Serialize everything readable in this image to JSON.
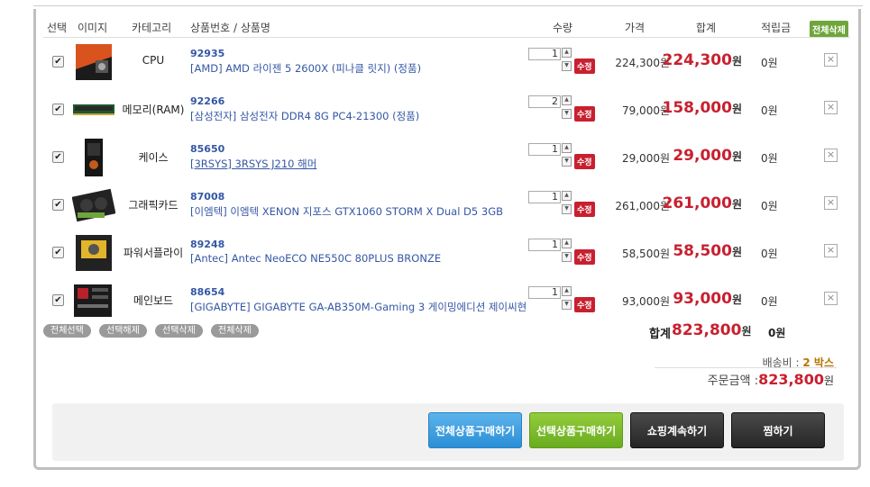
{
  "header": {
    "select": "선택",
    "image": "이미지",
    "category": "카테고리",
    "product": "상품번호 / 상품명",
    "qty": "수량",
    "price": "가격",
    "total": "합계",
    "points": "적립금",
    "delete_all": "전체삭제"
  },
  "items": [
    {
      "category": "CPU",
      "code": "92935",
      "name": "[AMD] AMD 라이젠 5 2600X (피나클 릿지) (정품)",
      "qty": "1",
      "price": "224,300원",
      "total": "224,300",
      "points": "0원",
      "thumb": "cpu-box",
      "link": false
    },
    {
      "category": "메모리(RAM)",
      "code": "92266",
      "name": "[삼성전자] 삼성전자 DDR4 8G PC4-21300 (정품)",
      "qty": "2",
      "price": "79,000원",
      "total": "158,000",
      "points": "0원",
      "thumb": "ram-stick",
      "link": false
    },
    {
      "category": "케이스",
      "code": "85650",
      "name": "[3RSYS] 3RSYS J210 해머",
      "qty": "1",
      "price": "29,000원",
      "total": "29,000",
      "points": "0원",
      "thumb": "pc-case",
      "link": true
    },
    {
      "category": "그래픽카드",
      "code": "87008",
      "name": "[이엠텍] 이엠텍 XENON 지포스 GTX1060 STORM X Dual D5 3GB",
      "qty": "1",
      "price": "261,000원",
      "total": "261,000",
      "points": "0원",
      "thumb": "gpu",
      "link": false
    },
    {
      "category": "파워서플라이",
      "code": "89248",
      "name": "[Antec] Antec NeoECO NE550C 80PLUS BRONZE",
      "qty": "1",
      "price": "58,500원",
      "total": "58,500",
      "points": "0원",
      "thumb": "psu",
      "link": false
    },
    {
      "category": "메인보드",
      "code": "88654",
      "name": "[GIGABYTE] GIGABYTE GA-AB350M-Gaming 3 게이밍에디션 제이씨현",
      "qty": "1",
      "price": "93,000원",
      "total": "93,000",
      "points": "0원",
      "thumb": "mainboard",
      "link": false
    }
  ],
  "row_labels": {
    "won": "원",
    "edit": "수정",
    "checkmark": "✔",
    "remove": "×",
    "up": "▲",
    "down": "▼"
  },
  "actions": {
    "select_all": "전체선택",
    "deselect": "선택해제",
    "delete_selected": "선택삭제",
    "delete_all": "전체삭제"
  },
  "summary": {
    "total_label": "합계",
    "total_value": "823,800",
    "won": "원",
    "total_points": "0원",
    "shipping_label": "배송비 : ",
    "shipping_value": "2 박스",
    "order_label": "주문금액 :",
    "order_value": "823,800"
  },
  "buttons": {
    "buy_all": "전체상품구매하기",
    "buy_selected": "선택상품구매하기",
    "continue": "쇼핑계속하기",
    "wish": "찜하기"
  },
  "colors": {
    "accent_red": "#c8202f",
    "link_blue": "#3457a5",
    "green": "#6fa63c",
    "blue_btn": "#3a9de0",
    "green_btn": "#78b829",
    "dark_btn": "#333333"
  }
}
